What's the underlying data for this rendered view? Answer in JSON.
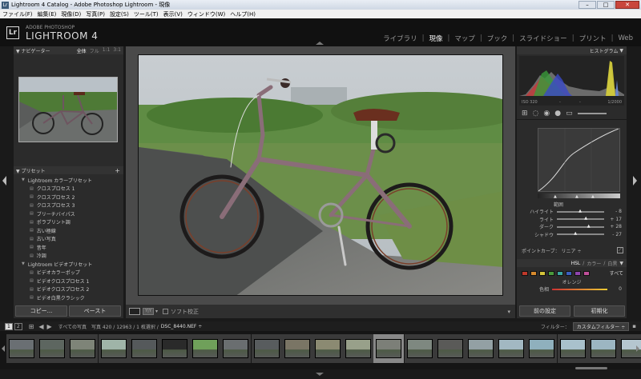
{
  "window": {
    "title": "Lightroom 4 Catalog - Adobe Photoshop Lightroom - 現像",
    "app_icon": "Lr"
  },
  "menu": [
    "ファイル(F)",
    "編集(E)",
    "現像(D)",
    "写真(P)",
    "設定(S)",
    "ツール(T)",
    "表示(V)",
    "ウィンドウ(W)",
    "ヘルプ(H)"
  ],
  "identity": {
    "logo": "Lr",
    "small": "ADOBE PHOTOSHOP",
    "big": "LIGHTROOM 4"
  },
  "modules": [
    {
      "label": "ライブラリ",
      "active": false
    },
    {
      "label": "現像",
      "active": true
    },
    {
      "label": "マップ",
      "active": false
    },
    {
      "label": "ブック",
      "active": false
    },
    {
      "label": "スライドショー",
      "active": false
    },
    {
      "label": "プリント",
      "active": false
    },
    {
      "label": "Web",
      "active": false
    }
  ],
  "navigator": {
    "title": "ナビゲーター",
    "zooms": [
      "全体",
      "フル",
      "1:1",
      "3:1"
    ]
  },
  "presets": {
    "title": "プリセット",
    "add": "+",
    "items": [
      {
        "label": "Lightroom カラープリセット",
        "folder": true
      },
      {
        "label": "クロスプロセス 1",
        "folder": false
      },
      {
        "label": "クロスプロセス 2",
        "folder": false
      },
      {
        "label": "クロスプロセス 3",
        "folder": false
      },
      {
        "label": "ブリーチバイパス",
        "folder": false
      },
      {
        "label": "ポラプリント調",
        "folder": false
      },
      {
        "label": "古い極線",
        "folder": false
      },
      {
        "label": "古い写真",
        "folder": false
      },
      {
        "label": "昔年",
        "folder": false
      },
      {
        "label": "冷調",
        "folder": false
      },
      {
        "label": "Lightroom ビデオプリセット",
        "folder": true
      },
      {
        "label": "ビデオカラーポップ",
        "folder": false
      },
      {
        "label": "ビデオクロスプロセス 1",
        "folder": false
      },
      {
        "label": "ビデオクロスプロセス 2",
        "folder": false
      },
      {
        "label": "ビデオ白黒クラシック",
        "folder": false
      }
    ]
  },
  "left_buttons": {
    "copy": "コピー...",
    "paste": "ペースト"
  },
  "right_buttons": {
    "previous": "前の設定",
    "reset": "初期化"
  },
  "histogram": {
    "title": "ヒストグラム",
    "iso": "ISO 320",
    "dash1": "-",
    "dash2": "-",
    "shutter": "1/2000"
  },
  "tone_curve": {
    "region_label": "範囲",
    "sliders": [
      {
        "label": "ハイライト",
        "value": "- 8",
        "pos": 0.46
      },
      {
        "label": "ライト",
        "value": "+ 17",
        "pos": 0.58
      },
      {
        "label": "ダーク",
        "value": "+ 28",
        "pos": 0.64
      },
      {
        "label": "シャドウ",
        "value": "- 27",
        "pos": 0.36
      }
    ],
    "point_curve_label": "ポイントカーブ： リニア ÷"
  },
  "hsl": {
    "tabs": [
      "HSL",
      "/",
      "カラー",
      "/",
      "白黒"
    ],
    "all": "すべて",
    "swatches": [
      "#c0392b",
      "#d68a2e",
      "#d4c43a",
      "#4a9a3c",
      "#3aa6a0",
      "#3b5fc0",
      "#8e44ad",
      "#c0509a"
    ],
    "section": "オレンジ",
    "hue_label": "色相",
    "hue_value": "0"
  },
  "toolbar": {
    "soft_proof": "ソフト校正"
  },
  "filmstrip_bar": {
    "pages": [
      "1",
      "2"
    ],
    "source": "すべての写真",
    "count": "写真 420 / 12963 / 1 枚選択 /",
    "file": "DSC_8440.NEF ÷",
    "filter_label": "フィルター：",
    "filter_value": "カスタムフィルター ÷"
  },
  "thumb_colors": [
    "#6a6f73",
    "#5d6660",
    "#7e8478",
    "#9fb4a8",
    "#55595b",
    "#2a2a2a",
    "#6fa05a",
    "#6a6e70",
    "#585c5e",
    "#7a7565",
    "#8b8a72",
    "#98a08a",
    "#7c7f78",
    "#7e8880",
    "#5a5a58",
    "#93a0a4",
    "#a2b8c2",
    "#8fb0bd",
    "#a9c1cc",
    "#9cb6c2",
    "#b5c6cf"
  ],
  "filmstrip_selected_index": 12
}
